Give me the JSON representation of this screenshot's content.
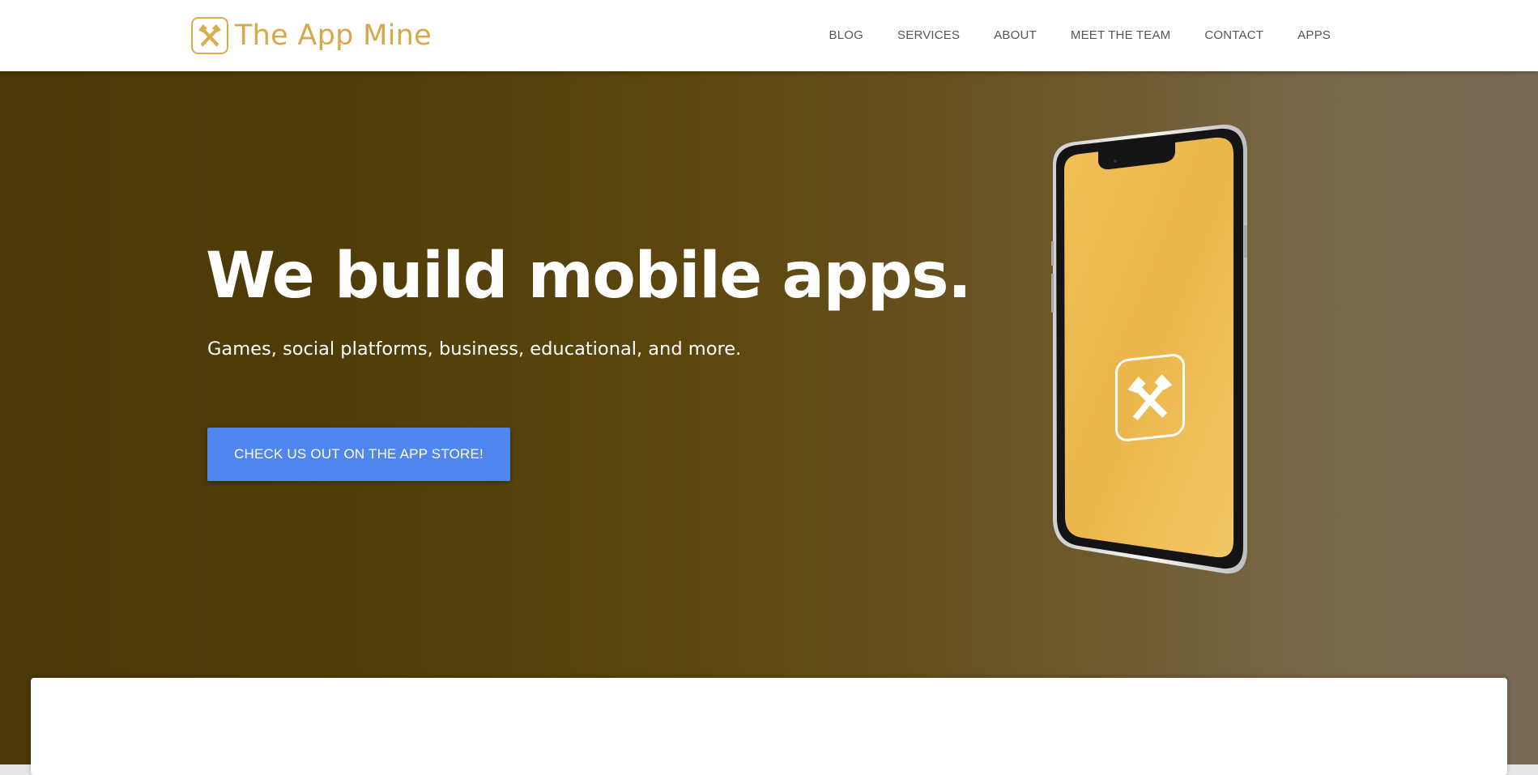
{
  "brand": {
    "name": "The App Mine",
    "logo_icon": "crossed-hammers-icon",
    "color": "#d6a84a"
  },
  "nav": {
    "items": [
      {
        "label": "BLOG"
      },
      {
        "label": "SERVICES"
      },
      {
        "label": "ABOUT"
      },
      {
        "label": "MEET THE TEAM"
      },
      {
        "label": "CONTACT"
      },
      {
        "label": "APPS"
      }
    ]
  },
  "hero": {
    "headline": "We build mobile apps.",
    "subheadline": "Games, social platforms, business, educational, and more.",
    "cta_label": "CHECK US OUT ON THE APP STORE!",
    "cta_color": "#4e86ee",
    "phone_screen_color": "#ebb74c",
    "phone_icon": "crossed-hammers-icon"
  }
}
